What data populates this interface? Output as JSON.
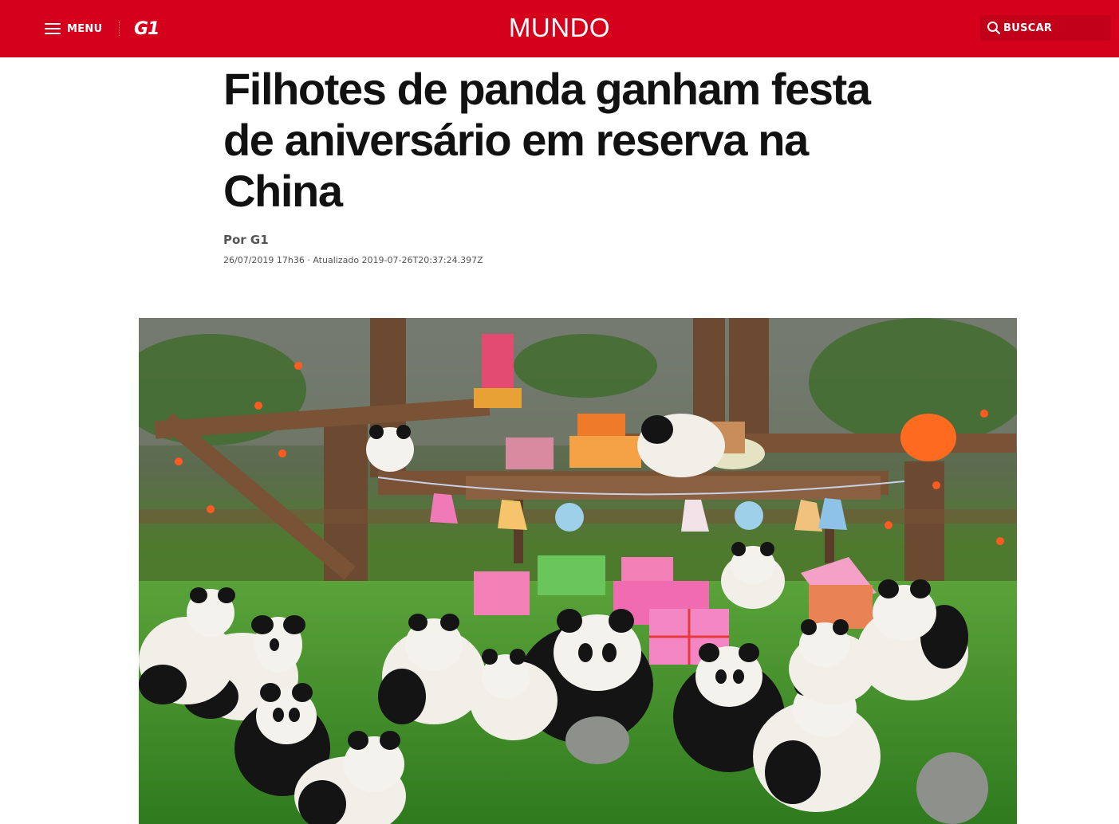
{
  "header": {
    "menu_label": "MENU",
    "logo_text": "G1",
    "section": "MUNDO",
    "search_label": "BUSCAR",
    "brand_color": "#d5001c"
  },
  "article": {
    "headline": "Filhotes de panda ganham festa de aniversário em reserva na China",
    "byline": "Por G1",
    "dateline": "26/07/2019 17h36 · Atualizado 2019-07-26T20:37:24.397Z"
  },
  "icons": {
    "menu": "hamburger-icon",
    "search": "search-icon"
  }
}
